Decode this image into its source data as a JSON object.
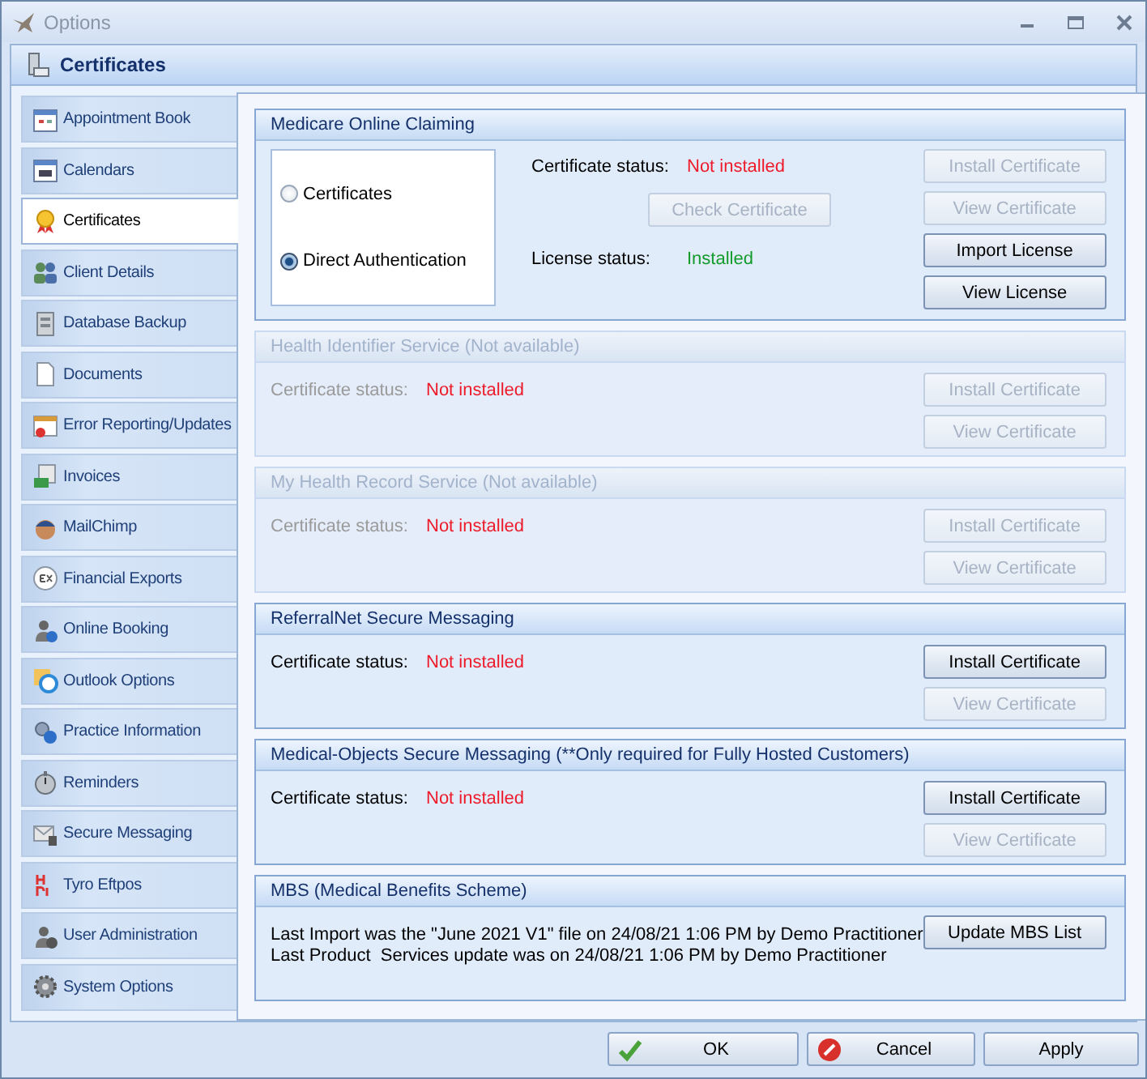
{
  "window": {
    "title": "Options"
  },
  "header": {
    "title": "Certificates"
  },
  "sidebar": {
    "items": [
      {
        "label": "Appointment Book",
        "selected": false
      },
      {
        "label": "Calendars",
        "selected": false
      },
      {
        "label": "Certificates",
        "selected": true
      },
      {
        "label": "Client Details",
        "selected": false
      },
      {
        "label": "Database Backup",
        "selected": false
      },
      {
        "label": "Documents",
        "selected": false
      },
      {
        "label": "Error Reporting/Updates",
        "selected": false
      },
      {
        "label": "Invoices",
        "selected": false
      },
      {
        "label": "MailChimp",
        "selected": false
      },
      {
        "label": "Financial Exports",
        "selected": false
      },
      {
        "label": "Online Booking",
        "selected": false
      },
      {
        "label": "Outlook Options",
        "selected": false
      },
      {
        "label": "Practice Information",
        "selected": false
      },
      {
        "label": "Reminders",
        "selected": false
      },
      {
        "label": "Secure Messaging",
        "selected": false
      },
      {
        "label": "Tyro Eftpos",
        "selected": false
      },
      {
        "label": "User Administration",
        "selected": false
      },
      {
        "label": "System Options",
        "selected": false
      }
    ]
  },
  "sections": [
    {
      "kind": "medicare",
      "title": "Medicare Online Claiming",
      "disabled": false,
      "options": [
        {
          "label": "Certificates",
          "selected": false
        },
        {
          "label": "Direct Authentication",
          "selected": true
        }
      ],
      "statuses": [
        {
          "label": "Certificate status:",
          "value": "Not installed",
          "ok": false
        },
        {
          "label": "License status:",
          "value": "Installed",
          "ok": true
        }
      ],
      "check_button": {
        "label": "Check Certificate",
        "disabled": true
      },
      "buttons": [
        {
          "label": "Install Certificate",
          "disabled": true
        },
        {
          "label": "View Certificate",
          "disabled": true
        },
        {
          "label": "Import License",
          "disabled": false
        },
        {
          "label": "View License",
          "disabled": false
        }
      ]
    },
    {
      "kind": "status",
      "title": "Health Identifier Service (Not available)",
      "disabled": true,
      "statuses": [
        {
          "label": "Certificate status:",
          "value": "Not installed",
          "ok": false
        }
      ],
      "buttons": [
        {
          "label": "Install Certificate",
          "disabled": true
        },
        {
          "label": "View Certificate",
          "disabled": true
        }
      ]
    },
    {
      "kind": "status",
      "title": "My Health Record Service (Not available)",
      "disabled": true,
      "statuses": [
        {
          "label": "Certificate status:",
          "value": "Not installed",
          "ok": false
        }
      ],
      "buttons": [
        {
          "label": "Install Certificate",
          "disabled": true
        },
        {
          "label": "View Certificate",
          "disabled": true
        }
      ]
    },
    {
      "kind": "status",
      "title": "ReferralNet Secure Messaging",
      "disabled": false,
      "statuses": [
        {
          "label": "Certificate status:",
          "value": "Not installed",
          "ok": false
        }
      ],
      "buttons": [
        {
          "label": "Install Certificate",
          "disabled": false
        },
        {
          "label": "View Certificate",
          "disabled": true
        }
      ]
    },
    {
      "kind": "status",
      "title": "Medical-Objects Secure Messaging (**Only required for Fully Hosted Customers)",
      "disabled": false,
      "statuses": [
        {
          "label": "Certificate status:",
          "value": "Not installed",
          "ok": false
        }
      ],
      "buttons": [
        {
          "label": "Install Certificate",
          "disabled": false
        },
        {
          "label": "View Certificate",
          "disabled": true
        }
      ]
    },
    {
      "kind": "mbs",
      "title": "MBS (Medical Benefits Scheme)",
      "disabled": false,
      "lines": [
        "Last Import was the \"June 2021 V1\" file on 24/08/21 1:06 PM by Demo Practitioner",
        "Last Product  Services update was on 24/08/21 1:06 PM by Demo Practitioner"
      ],
      "buttons": [
        {
          "label": "Update MBS List",
          "disabled": false
        }
      ]
    }
  ],
  "footer": {
    "buttons": [
      {
        "label": "OK",
        "kind": "ok"
      },
      {
        "label": "Cancel",
        "kind": "cancel"
      },
      {
        "label": "Apply",
        "kind": "plain"
      }
    ]
  }
}
